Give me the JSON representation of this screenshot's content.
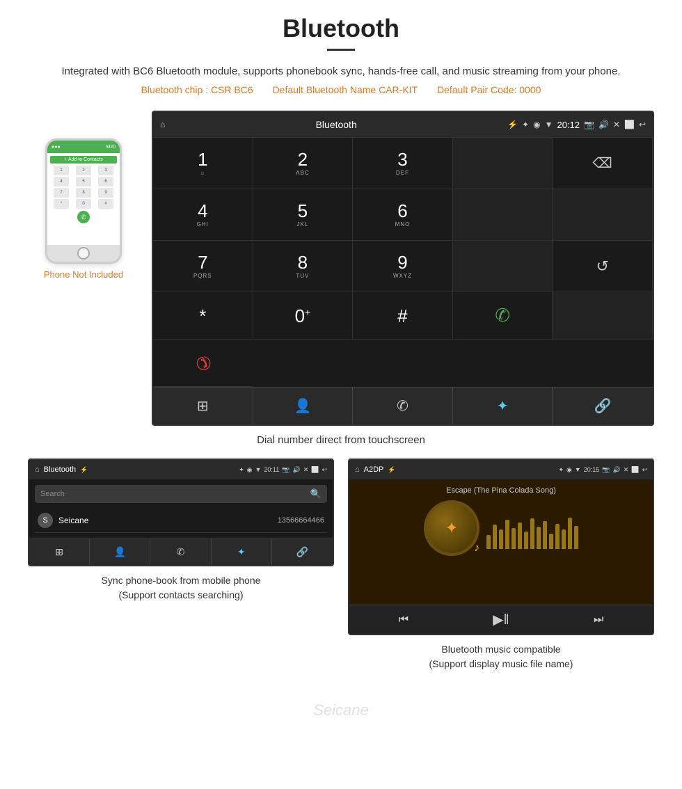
{
  "page": {
    "title": "Bluetooth",
    "description": "Integrated with BC6 Bluetooth module, supports phonebook sync, hands-free call, and music streaming from your phone.",
    "specs": {
      "chip": "Bluetooth chip : CSR BC6",
      "name": "Default Bluetooth Name CAR-KIT",
      "pair": "Default Pair Code: 0000"
    }
  },
  "dialpad_screen": {
    "header_title": "Bluetooth",
    "time": "20:12",
    "keys": [
      {
        "num": "1",
        "sub": "⌂",
        "type": "digit"
      },
      {
        "num": "2",
        "sub": "ABC",
        "type": "digit"
      },
      {
        "num": "3",
        "sub": "DEF",
        "type": "digit"
      },
      {
        "num": "",
        "sub": "",
        "type": "empty"
      },
      {
        "num": "⌫",
        "sub": "",
        "type": "action"
      }
    ],
    "keys2": [
      {
        "num": "4",
        "sub": "GHI",
        "type": "digit"
      },
      {
        "num": "5",
        "sub": "JKL",
        "type": "digit"
      },
      {
        "num": "6",
        "sub": "MNO",
        "type": "digit"
      },
      {
        "num": "",
        "sub": "",
        "type": "empty"
      },
      {
        "num": "",
        "sub": "",
        "type": "empty"
      }
    ],
    "keys3": [
      {
        "num": "7",
        "sub": "PQRS",
        "type": "digit"
      },
      {
        "num": "8",
        "sub": "TUV",
        "type": "digit"
      },
      {
        "num": "9",
        "sub": "WXYZ",
        "type": "digit"
      },
      {
        "num": "",
        "sub": "",
        "type": "empty"
      },
      {
        "num": "↺",
        "sub": "",
        "type": "action"
      }
    ],
    "keys4": [
      {
        "num": "*",
        "sub": "",
        "type": "digit"
      },
      {
        "num": "0",
        "sub": "+",
        "type": "digit"
      },
      {
        "num": "#",
        "sub": "",
        "type": "digit"
      },
      {
        "num": "✆",
        "sub": "",
        "type": "call_green"
      },
      {
        "num": "",
        "sub": "",
        "type": "empty"
      },
      {
        "num": "✆",
        "sub": "",
        "type": "call_red"
      }
    ],
    "toolbar": [
      "⊞",
      "👤",
      "✆",
      "✦",
      "🔗"
    ],
    "center_caption": "Dial number direct from touchscreen"
  },
  "phonebook_screen": {
    "header_title": "Bluetooth",
    "time": "20:11",
    "search_placeholder": "Search",
    "contact": {
      "letter": "S",
      "name": "Seicane",
      "number": "13566664466"
    },
    "caption_line1": "Sync phone-book from mobile phone",
    "caption_line2": "(Support contacts searching)"
  },
  "music_screen": {
    "header_title": "A2DP",
    "time": "20:15",
    "song_title": "Escape (The Pina Colada Song)",
    "eq_bars": [
      20,
      35,
      28,
      42,
      30,
      38,
      25,
      44,
      32,
      40,
      22,
      36,
      28,
      45,
      33
    ],
    "caption_line1": "Bluetooth music compatible",
    "caption_line2": "(Support display music file name)"
  },
  "phone_mockup": {
    "not_included_text": "Phone Not Included"
  },
  "watermark": "Seicane"
}
